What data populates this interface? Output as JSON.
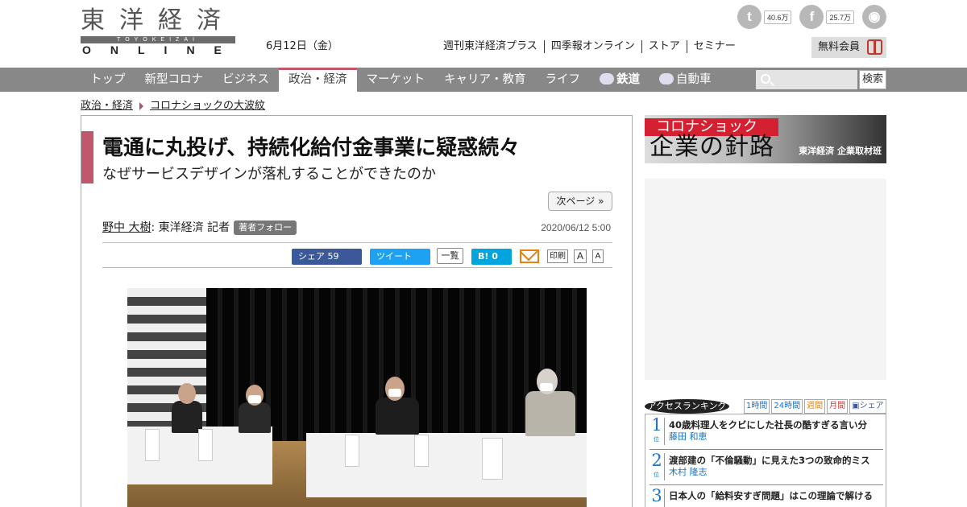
{
  "header": {
    "logo_kanji": "東洋経済",
    "logo_romaji": "TOYOKEIZAI",
    "logo_online": "ONLINE",
    "date": "6月12日（金）",
    "social": [
      {
        "icon": "twitter-icon",
        "glyph": "t",
        "count": "40.6万"
      },
      {
        "icon": "facebook-icon",
        "glyph": "f",
        "count": "25.7万"
      },
      {
        "icon": "rss-icon",
        "glyph": "◉",
        "count": ""
      }
    ],
    "site_links": [
      "週刊東洋経済プラス",
      "四季報オンライン",
      "ストア",
      "セミナー"
    ],
    "member_label": "無料会員"
  },
  "nav": {
    "items": [
      "トップ",
      "新型コロナ",
      "ビジネス",
      "政治・経済",
      "マーケット",
      "キャリア・教育",
      "ライフ",
      "鉄道",
      "自動車"
    ],
    "active_index": 3,
    "search_placeholder": "",
    "search_button": "検索"
  },
  "breadcrumb": [
    "政治・経済",
    "コロナショックの大波紋"
  ],
  "article": {
    "title": "電通に丸投げ、持続化給付金事業に疑惑続々",
    "subtitle": "なぜサービスデザインが落札することができたのか",
    "next_page": "次ページ »",
    "author_name": "野中 大樹",
    "author_affiliation": " : 東洋経済 記者",
    "follow_label": "著者フォロー",
    "published": "2020/06/12 5:00",
    "share": {
      "facebook_label": "シェア",
      "facebook_count": "59",
      "tweet_label": "ツイート",
      "list_label": "一覧",
      "hatena_label": "B!",
      "hatena_count": "0",
      "print_label": "印刷",
      "font_large": "A",
      "font_small": "A"
    }
  },
  "sidebar": {
    "banner_top": "コロナショック",
    "banner_main": "企業の針路",
    "banner_sub": "東洋経済 企業取材班",
    "ranking": {
      "title": "アクセスランキング",
      "tabs": [
        "1時間",
        "24時間",
        "週間",
        "月間",
        "シェア"
      ],
      "position_label": "位",
      "items": [
        {
          "rank": "1",
          "title": "40歳料理人をクビにした社長の酷すぎる言い分",
          "author": "藤田 和恵"
        },
        {
          "rank": "2",
          "title": "渡部建の「不倫騒動」に見えた3つの致命的ミス",
          "author": "木村 隆志"
        },
        {
          "rank": "3",
          "title": "日本人の「給料安すぎ問題」はこの理論で解ける",
          "author": ""
        }
      ]
    }
  },
  "colors": {
    "accent": "#c0576a",
    "nav_bg": "#888888",
    "link_blue": "#1a73c8",
    "facebook": "#3b5998",
    "twitter": "#1da1f2",
    "hatena": "#00a4de"
  }
}
